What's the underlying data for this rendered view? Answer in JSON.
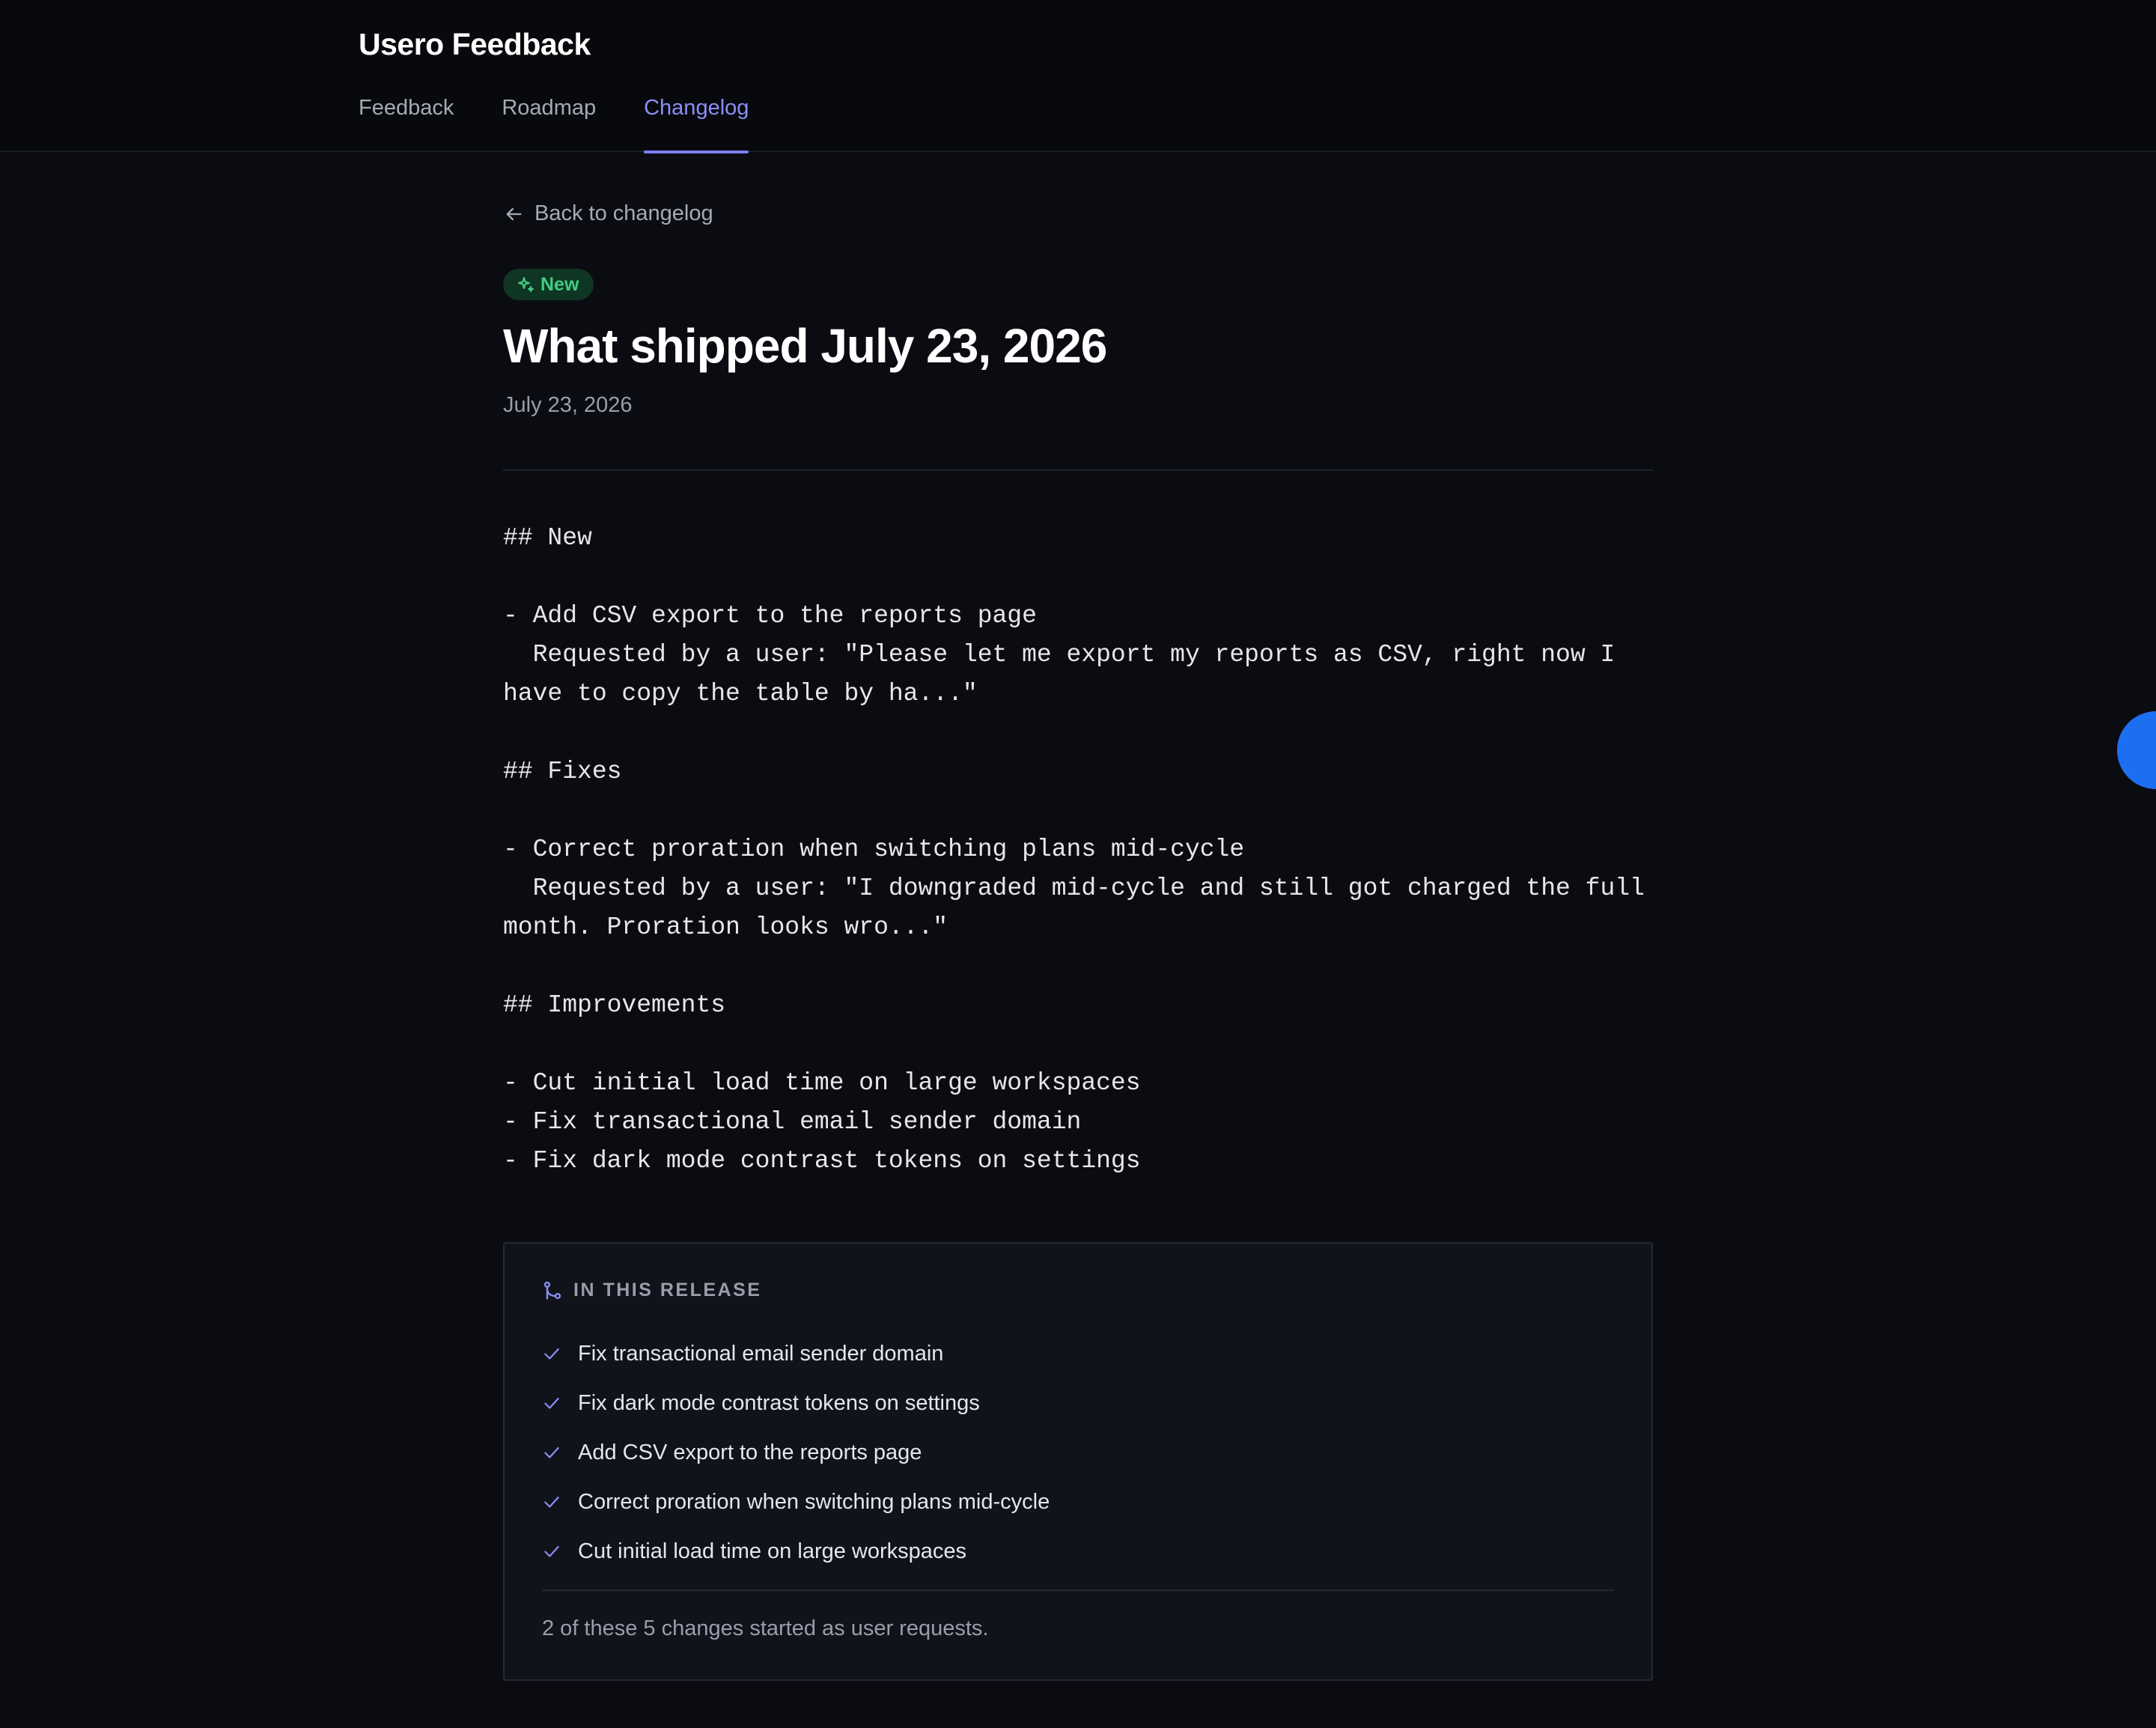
{
  "app": {
    "title": "Usero Feedback"
  },
  "nav": {
    "tabs": [
      {
        "label": "Feedback",
        "active": false
      },
      {
        "label": "Roadmap",
        "active": false
      },
      {
        "label": "Changelog",
        "active": true
      }
    ]
  },
  "back_link": {
    "label": "Back to changelog",
    "icon": "arrow-left-icon"
  },
  "entry": {
    "badge": {
      "label": "New",
      "icon": "sparkles-icon",
      "color": "#3fd07f"
    },
    "title": "What shipped July 23, 2026",
    "date": "July 23, 2026",
    "body": "## New\n\n- Add CSV export to the reports page\n  Requested by a user: \"Please let me export my reports as CSV, right now I have to copy the table by ha...\"\n\n## Fixes\n\n- Correct proration when switching plans mid-cycle\n  Requested by a user: \"I downgraded mid-cycle and still got charged the full month. Proration looks wro...\"\n\n## Improvements\n\n- Cut initial load time on large workspaces\n- Fix transactional email sender domain\n- Fix dark mode contrast tokens on settings"
  },
  "release": {
    "heading": "IN THIS RELEASE",
    "icon": "git-merge-icon",
    "items": [
      "Fix transactional email sender domain",
      "Fix dark mode contrast tokens on settings",
      "Add CSV export to the reports page",
      "Correct proration when switching plans mid-cycle",
      "Cut initial load time on large workspaces"
    ],
    "footer": "2 of these 5 changes started as user requests."
  },
  "colors": {
    "accent": "#7b7ff2",
    "badge_bg": "#0f3524",
    "widget": "#1d6ff2"
  }
}
